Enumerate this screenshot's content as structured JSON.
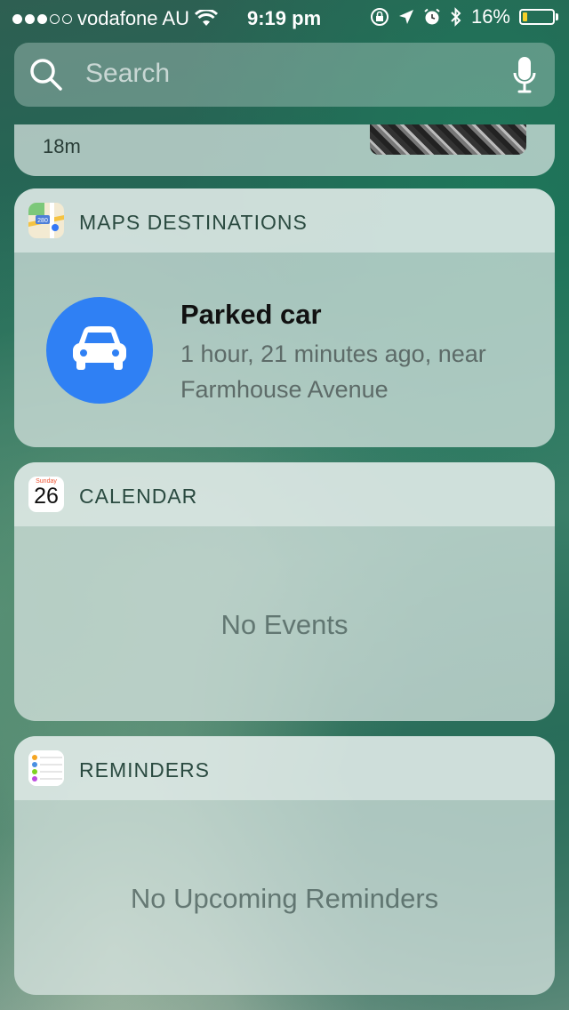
{
  "status_bar": {
    "carrier": "vodafone AU",
    "time": "9:19 pm",
    "battery_percent": "16%",
    "battery_level": 0.16,
    "signal_bars_filled": 3,
    "signal_bars_total": 5
  },
  "search": {
    "placeholder": "Search"
  },
  "top_widget": {
    "time_ago": "18m"
  },
  "maps_widget": {
    "title": "MAPS DESTINATIONS",
    "item_title": "Parked car",
    "item_subtitle": "1 hour, 21 minutes ago, near Farmhouse Avenue",
    "accent_color": "#2f80f4"
  },
  "calendar_widget": {
    "title": "CALENDAR",
    "icon_day": "Sunday",
    "icon_date": "26",
    "empty_message": "No Events"
  },
  "reminders_widget": {
    "title": "REMINDERS",
    "empty_message": "No Upcoming Reminders"
  }
}
